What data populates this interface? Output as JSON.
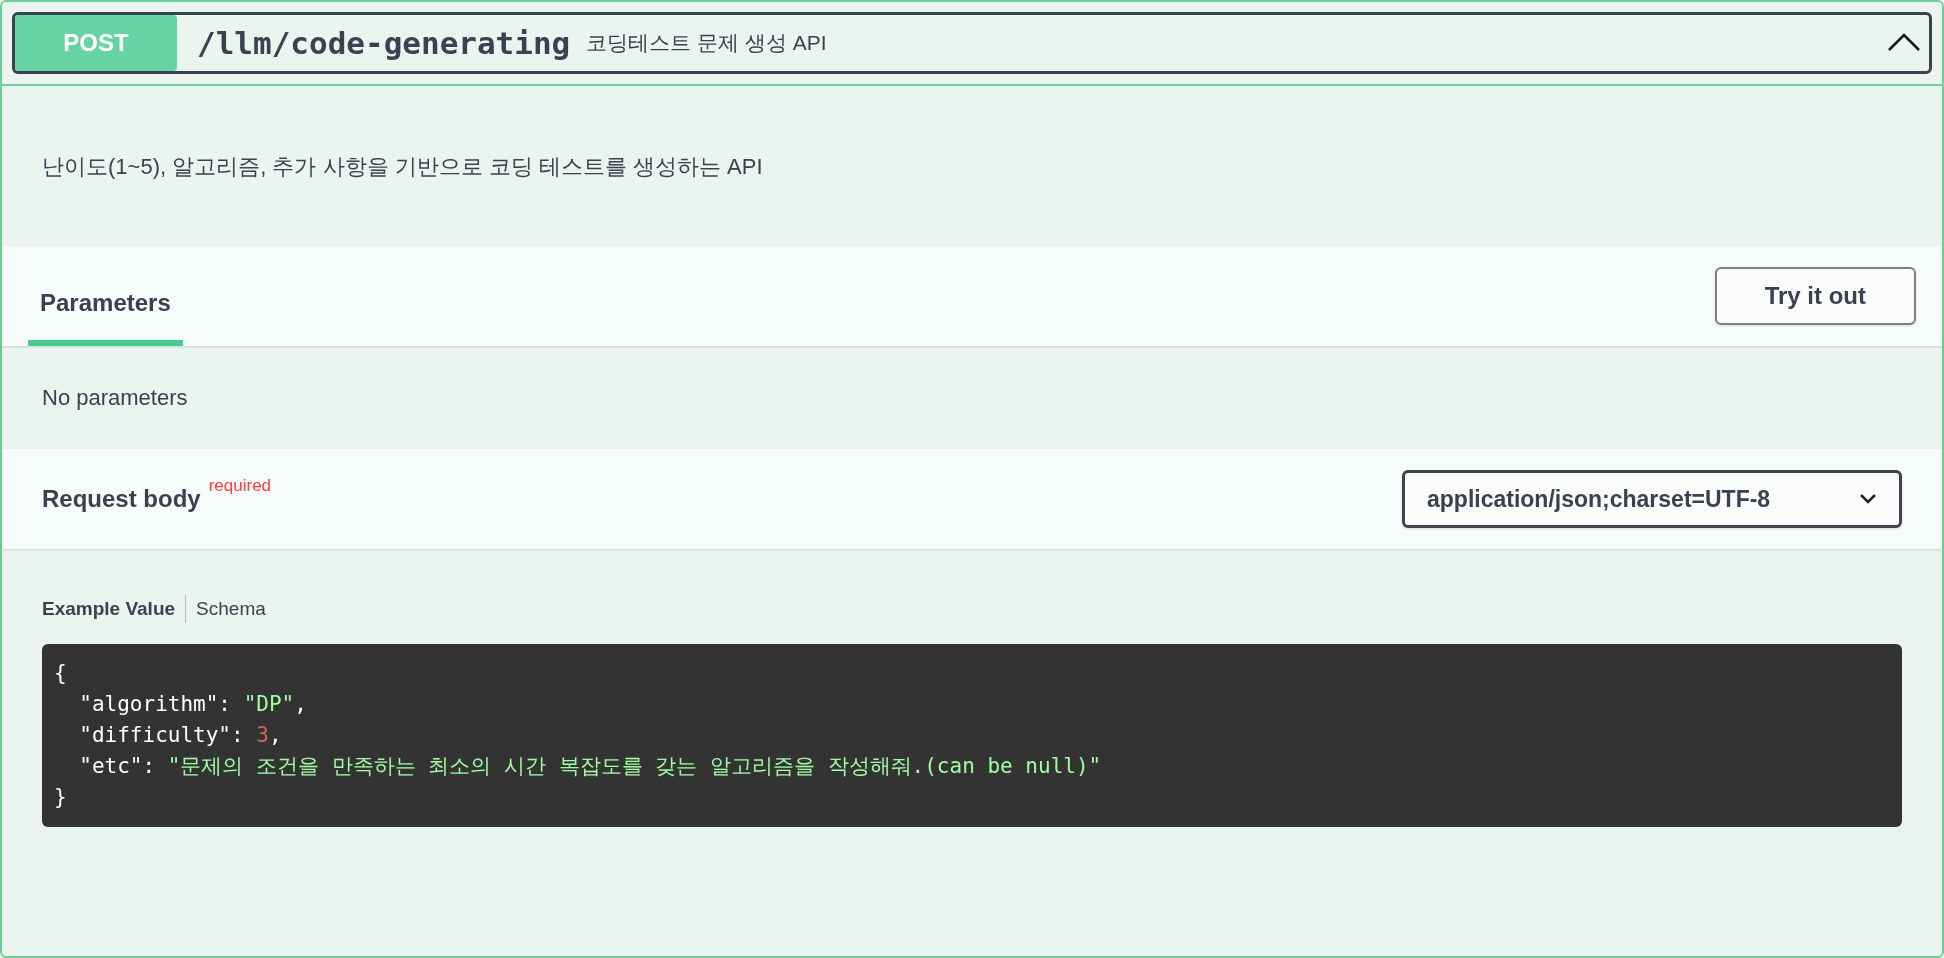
{
  "operation": {
    "method": "POST",
    "path": "/llm/code-generating",
    "summary": "코딩테스트 문제 생성 API",
    "expanded": true
  },
  "description": "난이도(1~5), 알고리즘, 추가 사항을 기반으로 코딩 테스트를 생성하는 API",
  "parameters": {
    "tabs": [
      {
        "label": "Parameters",
        "selected": true
      }
    ],
    "try_button": "Try it out",
    "empty_text": "No parameters"
  },
  "request_body": {
    "title": "Request body",
    "required_label": "required",
    "content_type": "application/json;charset=UTF-8"
  },
  "example_tabs": [
    {
      "label": "Example Value",
      "selected": true
    },
    {
      "label": "Schema",
      "selected": false
    }
  ],
  "code_lines": [
    [
      {
        "kind": "plain",
        "text": "{"
      }
    ],
    [
      {
        "kind": "plain",
        "text": "  \"algorithm\": "
      },
      {
        "kind": "string",
        "text": "\"DP\""
      },
      {
        "kind": "plain",
        "text": ","
      }
    ],
    [
      {
        "kind": "plain",
        "text": "  \"difficulty\": "
      },
      {
        "kind": "number",
        "text": "3"
      },
      {
        "kind": "plain",
        "text": ","
      }
    ],
    [
      {
        "kind": "plain",
        "text": "  \"etc\": "
      },
      {
        "kind": "string",
        "text": "\"문제의 조건을 만족하는 최소의 시간 복잡도를 갖는 알고리즘을 작성해줘.(can be null)\""
      }
    ],
    [
      {
        "kind": "plain",
        "text": "}"
      }
    ]
  ]
}
